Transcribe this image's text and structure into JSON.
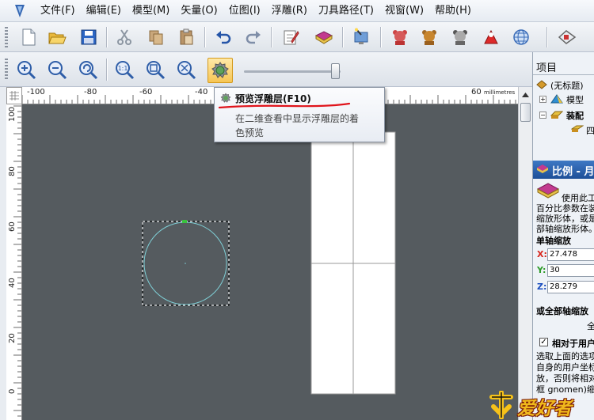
{
  "menu": {
    "items": [
      "文件(F)",
      "编辑(E)",
      "模型(M)",
      "矢量(O)",
      "位图(I)",
      "浮雕(R)",
      "刀具路径(T)",
      "视窗(W)",
      "帮助(H)"
    ]
  },
  "ruler": {
    "unit": "millimetres",
    "top_ticks": [
      "-100",
      "-80",
      "-60",
      "-40",
      "60"
    ],
    "left_ticks": [
      "100",
      "80",
      "60",
      "40",
      "20",
      "0"
    ]
  },
  "tooltip": {
    "title": "预览浮雕层(F10)",
    "line1": "在二维查看中显示浮雕层的着",
    "line2": "色预览"
  },
  "panel": {
    "header": "项目",
    "tree": {
      "root": "(无标题)",
      "model": "模型",
      "assembly": "装配",
      "child": "四"
    },
    "scale": {
      "title": "比例 - 月",
      "desc": [
        "使用此工",
        "百分比参数在装",
        "缩放形体，或是",
        "部轴缩放形体。"
      ],
      "single_axis": "单轴缩放",
      "x_label": "X:",
      "x_value": "27.478",
      "y_label": "Y:",
      "y_value": "30",
      "z_label": "Z:",
      "z_value": "28.279",
      "all_axes": "或全部轴缩放",
      "all_axes_sub": "全",
      "checkbox_label": "相对于用户",
      "note": [
        "选取上面的选项",
        "自身的用户坐标",
        "放，否则将相对",
        "框 gnomen)缩放"
      ]
    }
  },
  "watermark": "爱好者",
  "colors": {
    "canvas": "#555b5f",
    "circle": "#7fcfd6",
    "tooltip_underline": "#e0141b",
    "accent_blue": "#1b5aa8"
  }
}
